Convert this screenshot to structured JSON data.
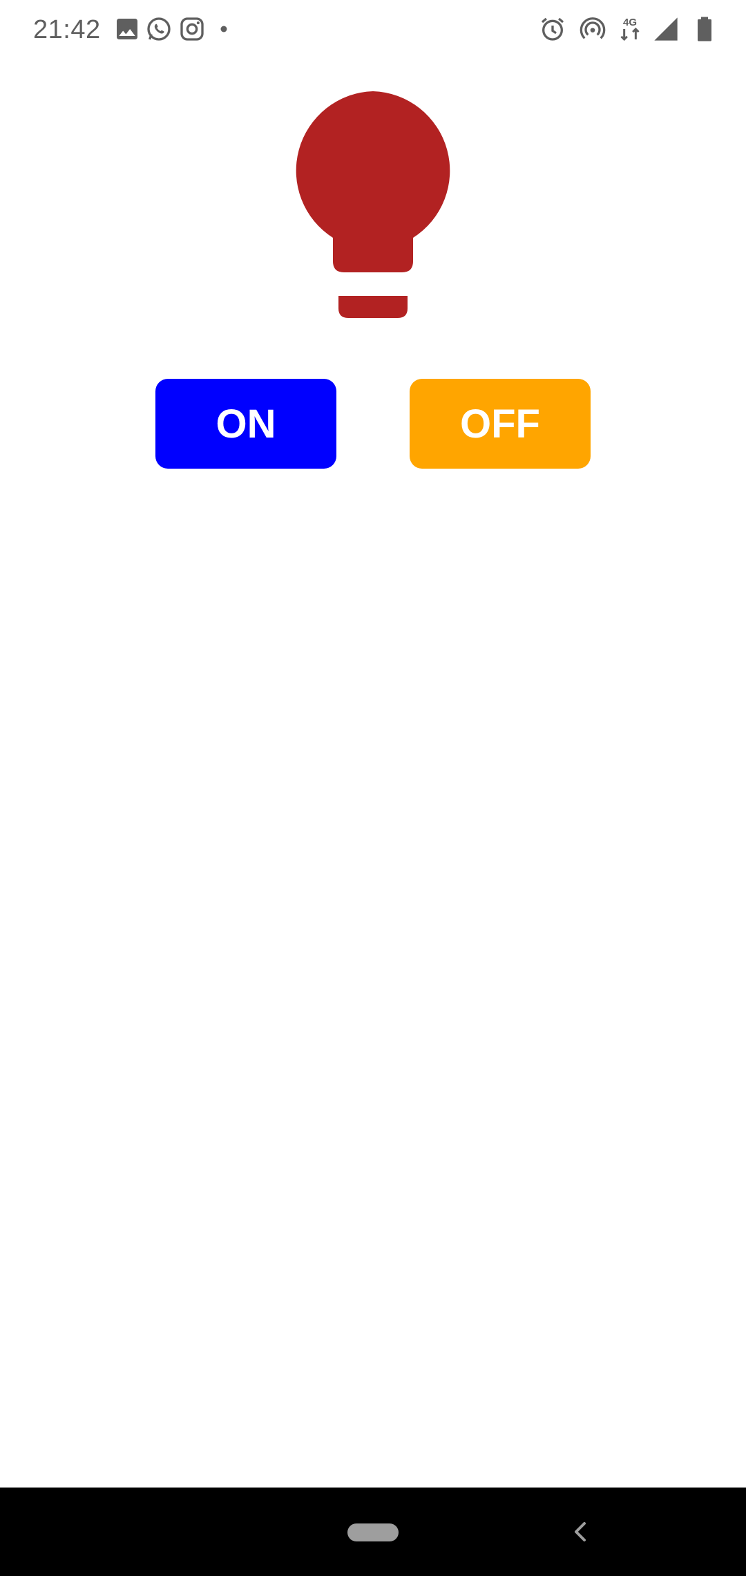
{
  "status_bar": {
    "time": "21:42",
    "network": "4G",
    "left_icons": [
      "image-icon",
      "whatsapp-icon",
      "instagram-icon",
      "dot-icon"
    ],
    "right_icons": [
      "alarm-icon",
      "hotspot-icon",
      "network-4g-icon",
      "signal-icon",
      "battery-icon"
    ],
    "icon_color": "#5f5f5f"
  },
  "bulb": {
    "icon": "lightbulb-icon",
    "color": "#b22222"
  },
  "controls": {
    "on_label": "ON",
    "on_color": "#0000ff",
    "off_label": "OFF",
    "off_color": "#ffa500"
  },
  "nav_bar": {
    "home_icon": "home-pill-icon",
    "back_icon": "back-icon"
  }
}
